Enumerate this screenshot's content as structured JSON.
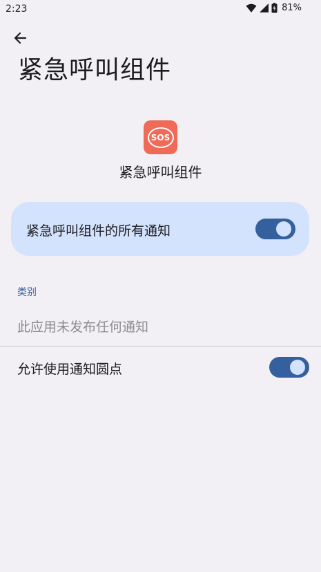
{
  "status_bar": {
    "time": "2:23",
    "battery": "81%"
  },
  "header": {
    "title": "紧急呼叫组件"
  },
  "app": {
    "icon_text": "SOS",
    "name": "紧急呼叫组件"
  },
  "master": {
    "label": "紧急呼叫组件的所有通知",
    "enabled": true
  },
  "category": {
    "header": "类别",
    "empty": "此应用未发布任何通知"
  },
  "dot": {
    "label": "允许使用通知圆点",
    "enabled": true
  },
  "colors": {
    "accent": "#35609e",
    "card": "#d3e3fd",
    "background": "#f2f0f5",
    "app_icon": "#ef6a57"
  }
}
